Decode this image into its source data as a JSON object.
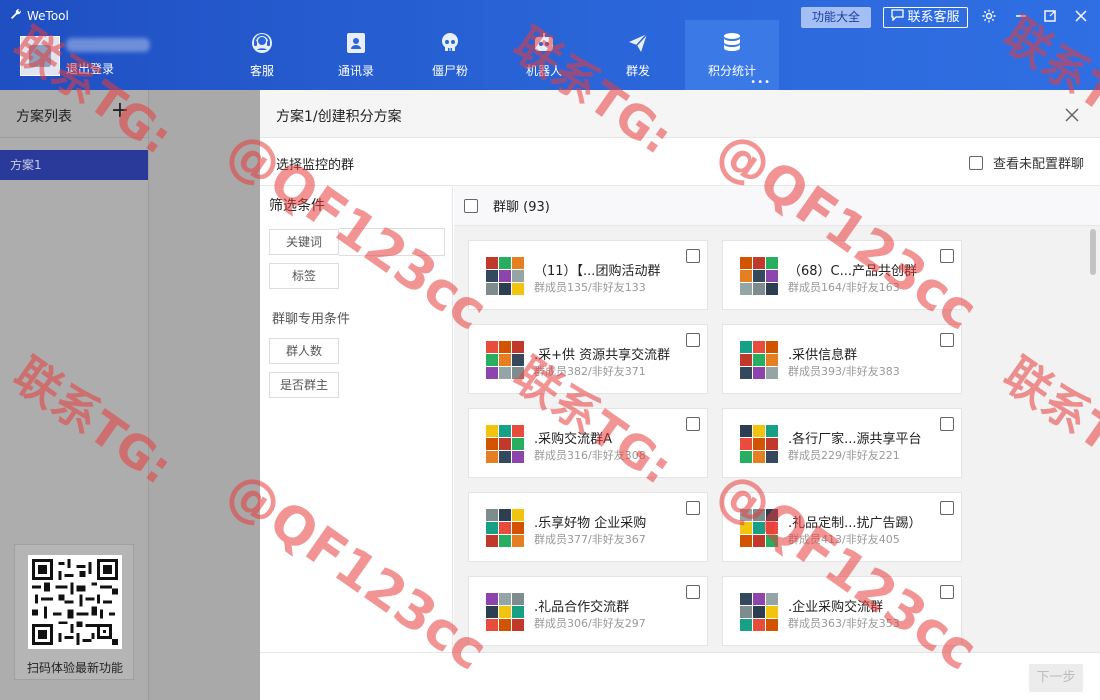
{
  "header": {
    "app_title": "WeTool",
    "logout": "退出登录",
    "features_button": "功能大全",
    "support_button": "联系客服",
    "nav": [
      {
        "label": "客服",
        "icon": "headset-icon"
      },
      {
        "label": "通讯录",
        "icon": "contacts-icon"
      },
      {
        "label": "僵尸粉",
        "icon": "skull-icon"
      },
      {
        "label": "机器人",
        "icon": "robot-icon"
      },
      {
        "label": "群发",
        "icon": "send-icon"
      },
      {
        "label": "积分统计",
        "icon": "database-icon",
        "active": true
      }
    ],
    "nav_more": "•••"
  },
  "sidebar": {
    "title": "方案列表",
    "add": "+",
    "items": [
      "方案1"
    ],
    "qr_caption": "扫码体验最新功能"
  },
  "panel": {
    "title": "方案1/创建积分方案",
    "select_label": "选择监控的群",
    "view_unconfigured": "查看未配置群聊",
    "filter": {
      "title": "筛选条件",
      "keyword": "关键词",
      "tag": "标签",
      "group_section": "群聊专用条件",
      "member_count": "群人数",
      "is_owner": "是否群主"
    },
    "groups_title": "群聊 (93)",
    "groups": [
      {
        "name": "（11）【...团购活动群",
        "meta": "群成员135/非好友133"
      },
      {
        "name": "（68）C...产品共创群",
        "meta": "群成员164/非好友163"
      },
      {
        "name": ".采+供 资源共享交流群",
        "meta": "群成员382/非好友371"
      },
      {
        "name": ".采供信息群",
        "meta": "群成员393/非好友383"
      },
      {
        "name": ".采购交流群A",
        "meta": "群成员316/非好友308"
      },
      {
        "name": ".各行厂家...源共享平台",
        "meta": "群成员229/非好友221"
      },
      {
        "name": ".乐享好物 企业采购",
        "meta": "群成员377/非好友367"
      },
      {
        "name": ".礼品定制...扰广告踢）",
        "meta": "群成员413/非好友405"
      },
      {
        "name": ".礼品合作交流群",
        "meta": "群成员306/非好友297"
      },
      {
        "name": ".企业采购交流群",
        "meta": "群成员363/非好友353"
      }
    ],
    "next_button": "下一步"
  },
  "watermark": {
    "line1": "联系TG:",
    "line2": "@QF123cc"
  },
  "colors": {
    "header_blue": "#2a66d9",
    "active_plan": "#2a3a9a",
    "watermark": "#e83c3c"
  }
}
